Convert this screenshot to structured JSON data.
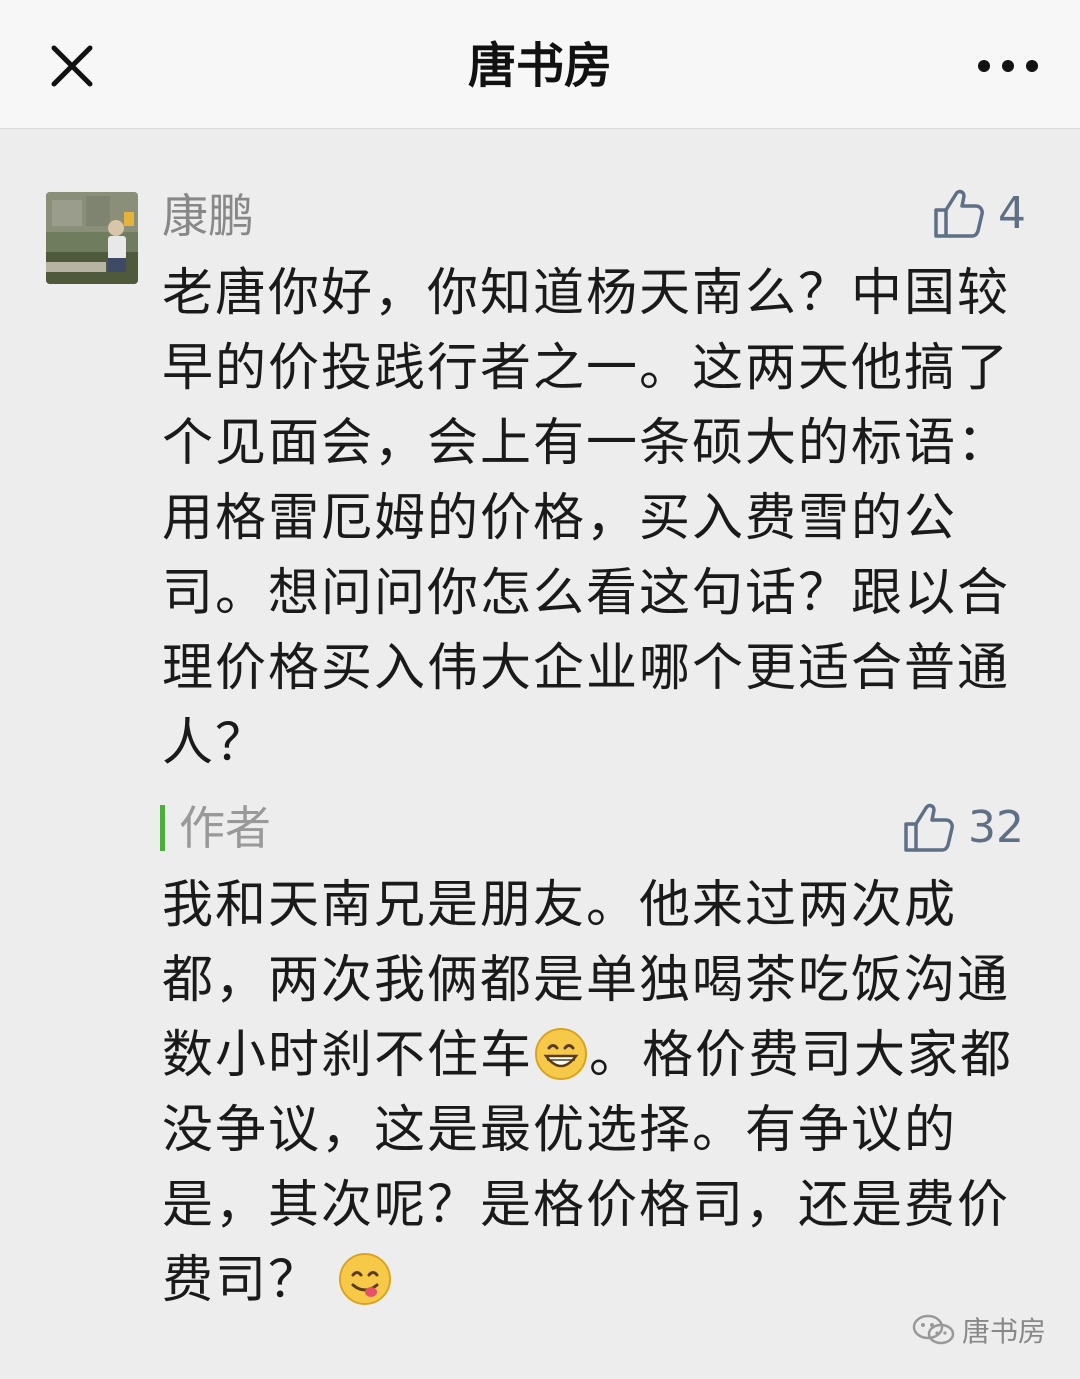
{
  "header": {
    "title": "唐书房"
  },
  "comment": {
    "username": "康鹏",
    "likes": "4",
    "text": "老唐你好，你知道杨天南么？中国较早的价投践行者之一。这两天他搞了个见面会，会上有一条硕大的标语：用格雷厄姆的价格，买入费雪的公司。想问问你怎么看这句话？跟以合理价格买入伟大企业哪个更适合普通人？"
  },
  "reply": {
    "author_label": "作者",
    "likes": "32",
    "text_part1": "我和天南兄是朋友。他来过两次成都，两次我俩都是单独喝茶吃饭沟通数小时刹不住车",
    "text_part2": "。格价费司大家都没争议，这是最优选择。有争议的是，其次呢？是格价格司，还是费价费司？",
    "emoji1": "grinning-face-emoji",
    "emoji2": "yum-face-emoji"
  },
  "watermark": {
    "text": "唐书房"
  },
  "colors": {
    "accent_green": "#4caf3c",
    "like_blue": "#5f6f85",
    "background": "#ededed"
  }
}
